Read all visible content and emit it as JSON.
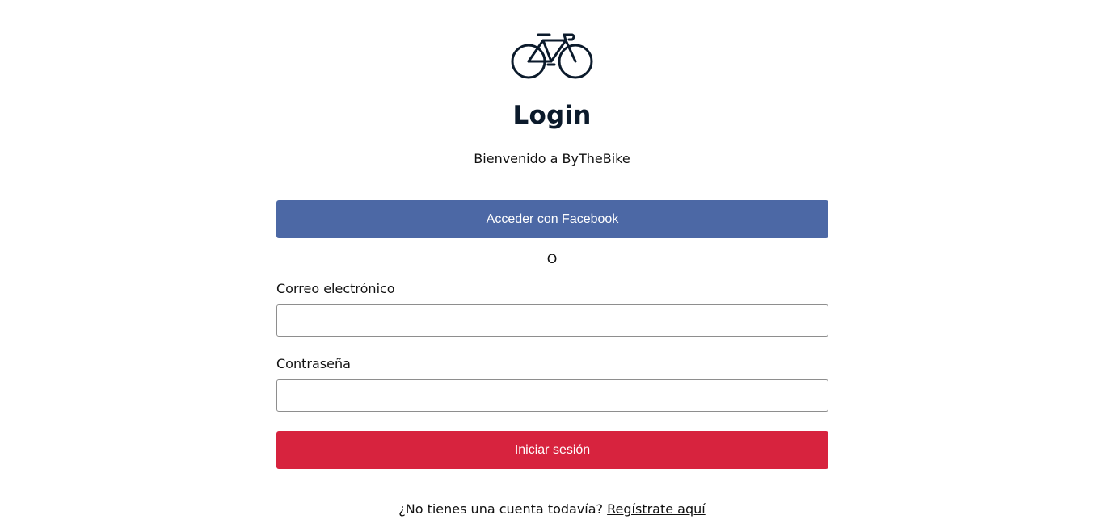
{
  "header": {
    "logo_icon": "bicycle-icon",
    "title": "Login",
    "subtitle": "Bienvenido a ByTheBike"
  },
  "social": {
    "facebook_label": "Acceder con Facebook"
  },
  "divider": {
    "text": "O"
  },
  "form": {
    "email_label": "Correo electrónico",
    "email_value": "",
    "password_label": "Contraseña",
    "password_value": "",
    "submit_label": "Iniciar sesión"
  },
  "footer": {
    "prompt": "¿No tienes una cuenta todavía?",
    "register_link": "Regístrate aquí"
  },
  "colors": {
    "facebook": "#4c68a5",
    "primary": "#d7233e",
    "heading": "#0b1a2b"
  }
}
